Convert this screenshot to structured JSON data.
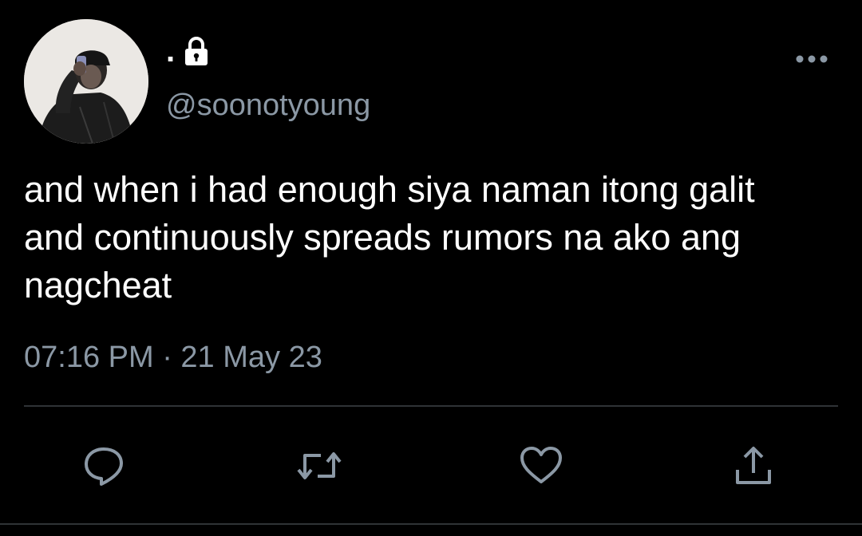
{
  "tweet": {
    "display_name": ".",
    "handle": "@soonotyoung",
    "text": "and when i had enough siya naman itong galit\nand continuously spreads rumors na ako ang\nnagcheat",
    "timestamp": "07:16 PM · 21 May 23",
    "protected": true
  },
  "icons": {
    "lock": "lock-icon",
    "more": "more-options-icon",
    "reply": "reply-icon",
    "retweet": "retweet-icon",
    "like": "like-icon",
    "share": "share-icon"
  },
  "colors": {
    "background": "#000000",
    "text_primary": "#ffffff",
    "text_secondary": "#8b98a5",
    "divider": "#2f3336",
    "icon": "#8b98a5"
  }
}
